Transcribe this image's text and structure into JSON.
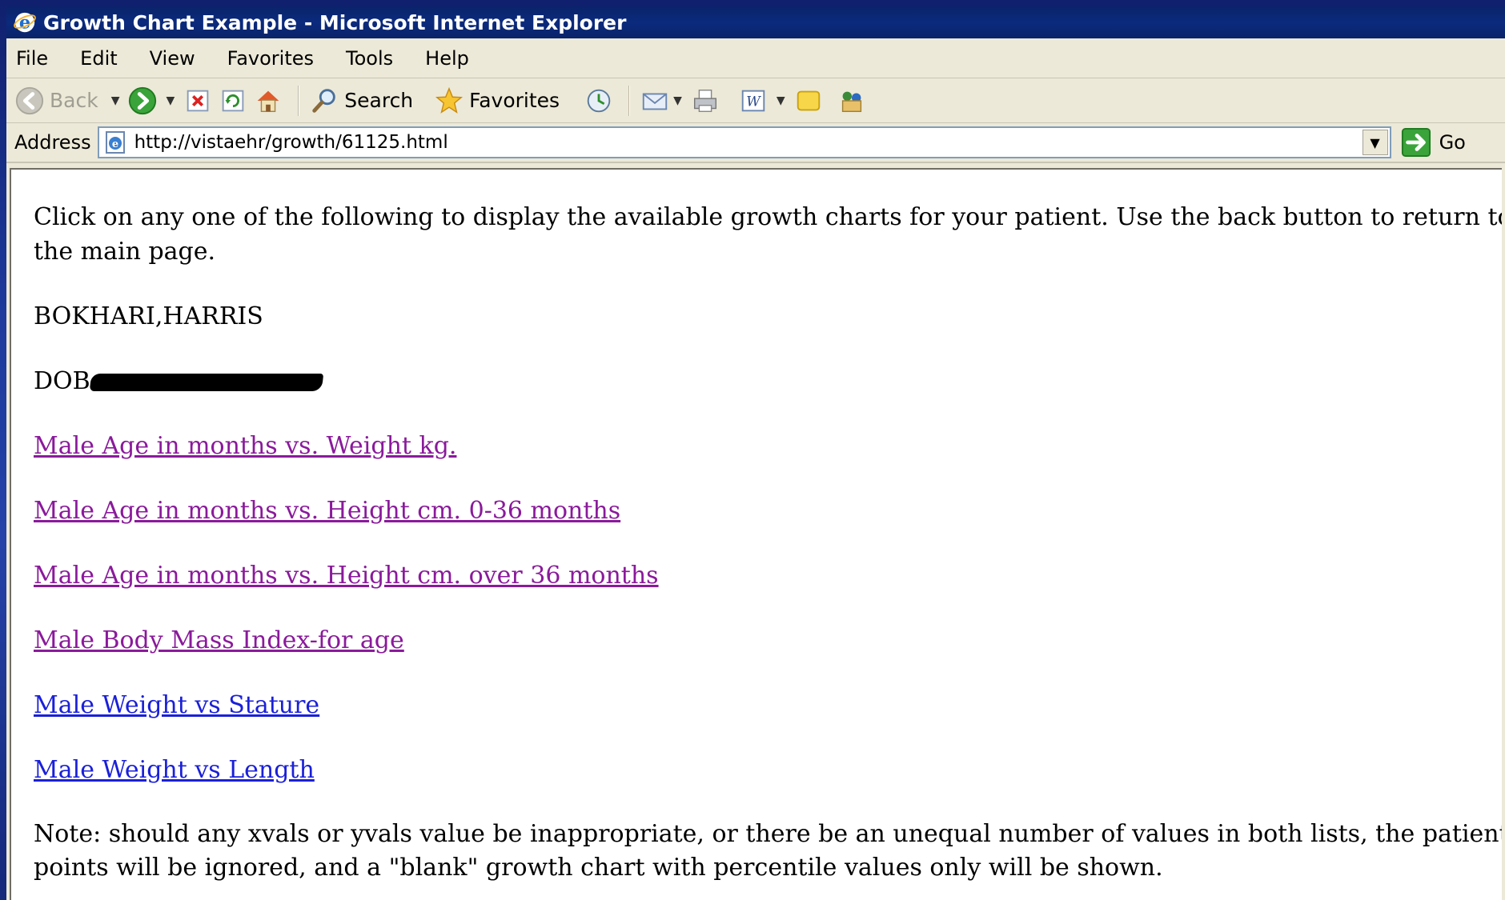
{
  "window": {
    "title": "Growth Chart Example - Microsoft Internet Explorer"
  },
  "menu": [
    "File",
    "Edit",
    "View",
    "Favorites",
    "Tools",
    "Help"
  ],
  "toolbar": {
    "back_label": "Back",
    "search_label": "Search",
    "favorites_label": "Favorites"
  },
  "address": {
    "label": "Address",
    "url": "http://vistaehr/growth/61125.html",
    "go_label": "Go"
  },
  "content": {
    "intro": "Click on any one of the following to display the available growth charts for your patient. Use the back button to return to the main page.",
    "patient_name": "BOKHARI,HARRIS",
    "dob_label": "DOB",
    "links": [
      {
        "label": "Male Age in months vs. Weight kg.",
        "visited": true
      },
      {
        "label": "Male Age in months vs. Height cm. 0-36 months",
        "visited": true
      },
      {
        "label": "Male Age in months vs. Height cm. over 36 months",
        "visited": true
      },
      {
        "label": "Male Body Mass Index-for age",
        "visited": true
      },
      {
        "label": "Male Weight vs Stature",
        "visited": false
      },
      {
        "label": "Male Weight vs Length",
        "visited": false
      }
    ],
    "note": "Note: should any xvals or yvals value be inappropriate, or there be an unequal number of values in both lists, the patient points will be ignored, and a \"blank\" growth chart with percentile values only will be shown."
  },
  "colors": {
    "visited_link": "#8a1a9b",
    "unvisited_link": "#1a20d8",
    "titlebar": "#0a246a"
  }
}
